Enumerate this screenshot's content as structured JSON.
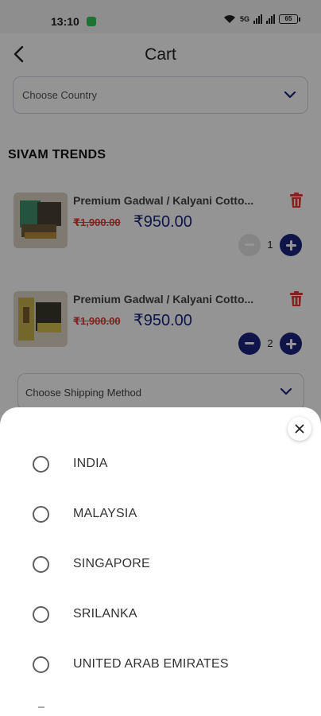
{
  "status_bar": {
    "time": "13:10",
    "network_label": "5G",
    "battery": "65"
  },
  "header": {
    "title": "Cart",
    "back_icon": "back-arrow-icon"
  },
  "country_select": {
    "placeholder": "Choose Country"
  },
  "store": {
    "name": "SIVAM TRENDS"
  },
  "cart_items": [
    {
      "name": "Premium Gadwal / Kalyani Cotto...",
      "original_price": "₹1,900.00",
      "price": "₹950.00",
      "quantity": "1"
    },
    {
      "name": "Premium Gadwal / Kalyani Cotto...",
      "original_price": "₹1,900.00",
      "price": "₹950.00",
      "quantity": "2"
    }
  ],
  "shipping_select": {
    "placeholder": "Choose Shipping Method"
  },
  "country_sheet": {
    "options": [
      "INDIA",
      "MALAYSIA",
      "SINGAPORE",
      "SRILANKA",
      "UNITED ARAB EMIRATES"
    ]
  },
  "colors": {
    "accent": "#1a237e",
    "strike_price": "#e53935",
    "trash": "#e53935"
  }
}
